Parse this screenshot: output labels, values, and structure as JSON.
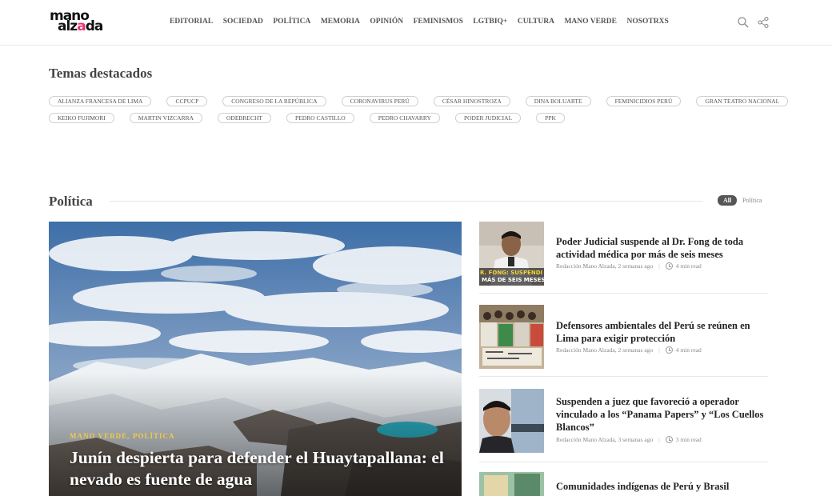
{
  "header": {
    "logo_line1": "mano",
    "logo_line2_a": "alz",
    "logo_line2_b": "a",
    "logo_line2_c": "da",
    "nav": [
      "EDITORIAL",
      "SOCIEDAD",
      "POLÍTICA",
      "MEMORIA",
      "OPINIÓN",
      "FEMINISMOS",
      "LGTBIQ+",
      "CULTURA",
      "MANO VERDE",
      "NOSOTRXS"
    ],
    "icons": [
      "search-icon",
      "share-icon"
    ]
  },
  "featured_topics": {
    "title": "Temas destacados",
    "row1": [
      "ALIANZA FRANCESA DE LIMA",
      "CCPUCP",
      "CONGRESO DE LA REPÚBLICA",
      "CORONAVIRUS PERÚ",
      "CÉSAR HINOSTROZA",
      "DINA BOLUARTE",
      "FEMINICIDIOS PERÚ",
      "GRAN TEATRO NACIONAL"
    ],
    "row2": [
      "KEIKO FUJIMORI",
      "MARTIN VIZCARRA",
      "ODEBRECHT",
      "PEDRO CASTILLO",
      "PEDRO CHAVARRY",
      "PODER JUDICIAL",
      "PPK"
    ]
  },
  "politica": {
    "title": "Política",
    "filters": [
      "All",
      "Política"
    ],
    "hero": {
      "categories": [
        "MANO VERDE",
        "POLÍTICA"
      ],
      "cat_sep": ",",
      "title": "Junín despierta para defender el Huaytapallana: el nevado es fuente de agua"
    },
    "items": [
      {
        "title": "Poder Judicial suspende al Dr. Fong de toda actividad médica por más de seis meses",
        "meta": "Redacción Mano Alzada, 2 semanas ago",
        "read": "4 min read",
        "thumb_caption_1": "R. FONG: SUSPENDI",
        "thumb_caption_2": "MÁS DE SEIS MESES"
      },
      {
        "title": "Defensores ambientales del Perú se reúnen en Lima para exigir protección",
        "meta": "Redacción Mano Alzada, 2 semanas ago",
        "read": "4 min read"
      },
      {
        "title": "Suspenden a juez que favoreció a operador vinculado a los “Panama Papers” y “Los Cuellos Blancos”",
        "meta": "Redacción Mano Alzada, 3 semanas ago",
        "read": "3 min read"
      },
      {
        "title": "Comunidades indígenas de Perú y Brasil"
      }
    ]
  },
  "colors": {
    "accent": "#e5336f",
    "category": "#f0c94a",
    "filter_active_bg": "#555555"
  }
}
